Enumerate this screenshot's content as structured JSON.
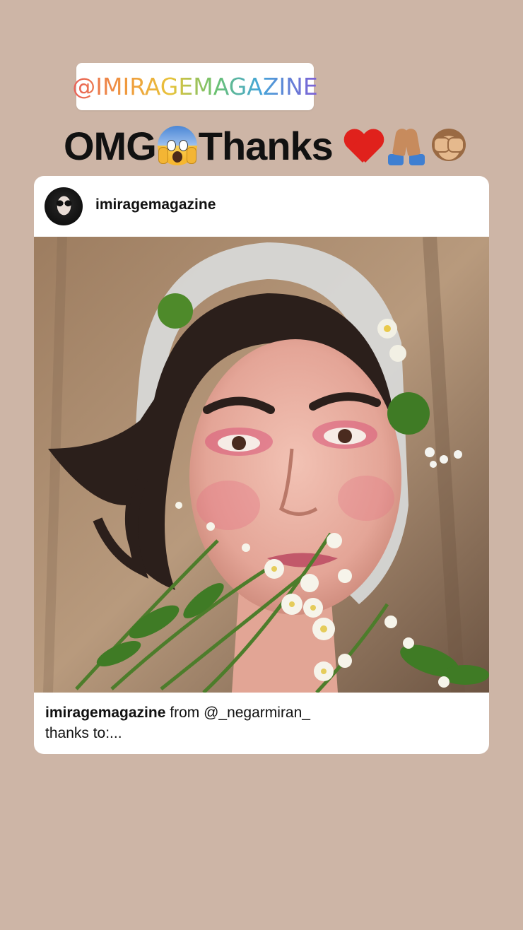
{
  "mention_sticker": {
    "text": "@IMIRAGEMAGAZINE"
  },
  "story_caption": {
    "text_1": "OMG",
    "text_2": "Thanks",
    "emojis": [
      "face-screaming-in-fear",
      "red-heart",
      "folded-hands",
      "see-no-evil-monkey"
    ]
  },
  "post": {
    "username": "imiragemagazine",
    "caption_user": "imiragemagazine",
    "caption_text": " from @_negarmiran_",
    "caption_line2": "thanks to:..."
  },
  "colors": {
    "background": "#cdb5a6",
    "card": "#ffffff",
    "text": "#111111"
  }
}
